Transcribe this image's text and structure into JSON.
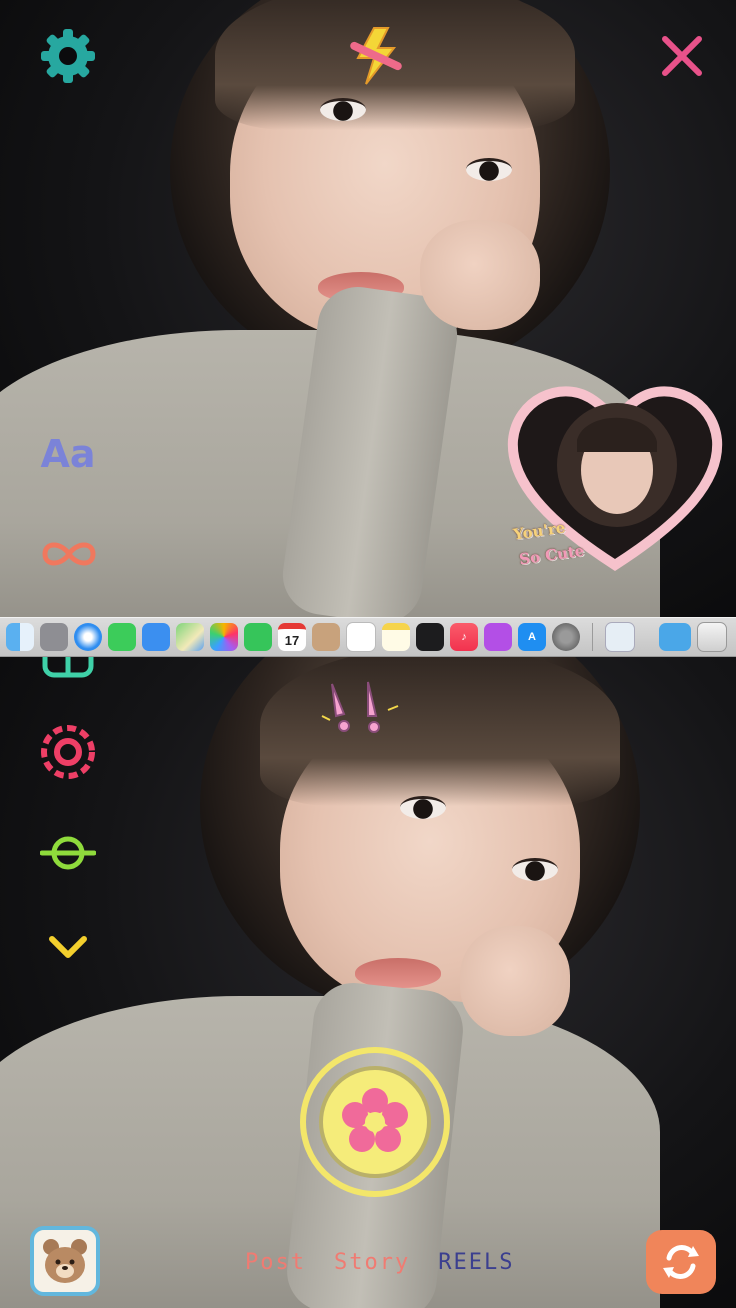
{
  "colors": {
    "settings": "#27a8a0",
    "close": "#e8528a",
    "text_tool": "#7b83d8",
    "boomerang": "#f0785e",
    "layout": "#3fd1a8",
    "timer": "#ee3f66",
    "filter": "#8fdb3c",
    "chevron": "#f3cf2d",
    "shutter": "#f3e66a",
    "flower": "#f06a9a",
    "flip": "#f0855a",
    "gallery_bg": "#62b7dd"
  },
  "top_bar": {
    "settings_icon": "gear-icon",
    "close_icon": "close-icon"
  },
  "left_tools": [
    {
      "name": "text-tool",
      "label": "Aa",
      "icon": "text-icon"
    },
    {
      "name": "boomerang-tool",
      "icon": "infinity-icon"
    },
    {
      "name": "layout-tool",
      "icon": "layout-icon"
    },
    {
      "name": "timer-tool",
      "icon": "dashed-circle-icon"
    },
    {
      "name": "filter-tool",
      "icon": "circle-line-icon"
    },
    {
      "name": "more-tools",
      "icon": "chevron-down-icon"
    }
  ],
  "sticker": {
    "line1": "You're",
    "line2": "So Cute"
  },
  "dock": {
    "calendar_day": "17",
    "apps": [
      "finder",
      "launchpad",
      "safari",
      "messages",
      "mail",
      "maps",
      "photos",
      "facetime",
      "calendar",
      "contacts",
      "reminders",
      "notes",
      "tv",
      "music",
      "podcasts",
      "app-store",
      "system-settings",
      "preview",
      "downloads",
      "trash"
    ]
  },
  "modes": [
    {
      "label": "Post",
      "color": "#f07b72"
    },
    {
      "label": "Story",
      "color": "#f07b72"
    },
    {
      "label": "REELS",
      "color": "#3b3f8f"
    }
  ]
}
